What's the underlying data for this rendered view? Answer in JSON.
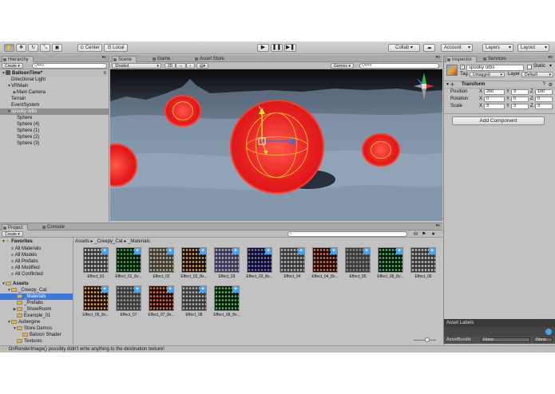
{
  "toolbar": {
    "pivot_label": "Center",
    "space_label": "Local",
    "collab_label": "Collab ▾",
    "account_label": "Account",
    "layers_label": "Layers",
    "layout_label": "Layout"
  },
  "hierarchy": {
    "tab": "Hierarchy",
    "create_label": "Create ▾",
    "search_placeholder": "Q▾All",
    "scene_name": "BalloonTime*",
    "items": [
      {
        "label": "Directional Light",
        "indent": 1
      },
      {
        "label": "VRMain",
        "indent": 1,
        "arrow": "▼"
      },
      {
        "label": "Main Camera",
        "indent": 2,
        "arrow": "▶"
      },
      {
        "label": "Terrain",
        "indent": 1
      },
      {
        "label": "EventSystem",
        "indent": 1
      },
      {
        "label": "spooky orbs",
        "indent": 1,
        "arrow": "▼",
        "selected": true
      },
      {
        "label": "Sphere",
        "indent": 2
      },
      {
        "label": "Sphere (4)",
        "indent": 2
      },
      {
        "label": "Sphere (1)",
        "indent": 2
      },
      {
        "label": "Sphere (2)",
        "indent": 2
      },
      {
        "label": "Sphere (3)",
        "indent": 2
      }
    ]
  },
  "scene": {
    "tabs": [
      "Scene",
      "Game",
      "Asset Store"
    ],
    "shading_label": "Shaded",
    "mode_2d": "2D",
    "gizmos_label": "Gizmos ▾",
    "search_placeholder": "Q▾All"
  },
  "inspector": {
    "tabs": [
      "Inspector",
      "Services"
    ],
    "object_name": "spooky orbs",
    "static_label": "Static",
    "tag_label": "Tag",
    "tag_value": "Untagged",
    "layer_label": "Layer",
    "layer_value": "Default",
    "transform_label": "Transform",
    "position_label": "Position",
    "rotation_label": "Rotation",
    "scale_label": "Scale",
    "position": {
      "x": "260",
      "y": "3",
      "z": "100"
    },
    "rotation": {
      "x": "0",
      "y": "0",
      "z": "0"
    },
    "scale": {
      "x": "3",
      "y": "3",
      "z": "3"
    },
    "add_component_label": "Add Component",
    "asset_labels": "Asset Labels",
    "assetbundle_label": "AssetBundle",
    "assetbundle_value": "None",
    "assetbundle_variant": "None"
  },
  "project": {
    "tabs": [
      "Project",
      "Console"
    ],
    "create_label": "Create ▾",
    "breadcrumb": [
      "Assets",
      "_Creepy_Cat",
      "_Materials"
    ],
    "favorites_label": "Favorites",
    "favorites": [
      "All Materials",
      "All Models",
      "All Prefabs",
      "All Modified",
      "All Conflicted"
    ],
    "assets_label": "Assets",
    "tree": [
      {
        "label": "_Creepy_Cat",
        "indent": 1,
        "arrow": "▼"
      },
      {
        "label": "_Materials",
        "indent": 2,
        "selected": true
      },
      {
        "label": "_Prefabs",
        "indent": 2
      },
      {
        "label": "_ShowRoom",
        "indent": 2,
        "arrow": "▶"
      },
      {
        "label": "Example_01",
        "indent": 2
      },
      {
        "label": "Aubergine",
        "indent": 1,
        "arrow": "▼"
      },
      {
        "label": "Store Demos",
        "indent": 2,
        "arrow": "▼"
      },
      {
        "label": "Baloon Shader",
        "indent": 3
      },
      {
        "label": "Textures",
        "indent": 2
      }
    ],
    "materials": [
      {
        "label": "Effect_01",
        "color": "#cccccc"
      },
      {
        "label": "Effect_01_8x...",
        "color": "#22c33a"
      },
      {
        "label": "Effect_02",
        "color": "#c8b48a"
      },
      {
        "label": "Effect_02_8x...",
        "color": "#f0a040"
      },
      {
        "label": "Effect_03",
        "color": "#b0a0ff"
      },
      {
        "label": "Effect_03_8x...",
        "color": "#6e6eff"
      },
      {
        "label": "Effect_04",
        "color": "#bdbdbd"
      },
      {
        "label": "Effect_04_8x...",
        "color": "#ff6a3a"
      },
      {
        "label": "Effect_05",
        "color": "#8c8c8c"
      },
      {
        "label": "Effect_05_8x...",
        "color": "#33cc55"
      },
      {
        "label": "Effect_06",
        "color": "#c5c5c5"
      },
      {
        "label": "Effect_06_8x...",
        "color": "#ffa036"
      },
      {
        "label": "Effect_07",
        "color": "#9a9a9a"
      },
      {
        "label": "Effect_07_8x...",
        "color": "#ff6a3a"
      },
      {
        "label": "Effect_08",
        "color": "#b5b5b5"
      },
      {
        "label": "Effect_08_8x...",
        "color": "#3ad04a"
      }
    ]
  },
  "status": {
    "message": "OnRenderImage() possibly didn't write anything to the destination texture!"
  }
}
